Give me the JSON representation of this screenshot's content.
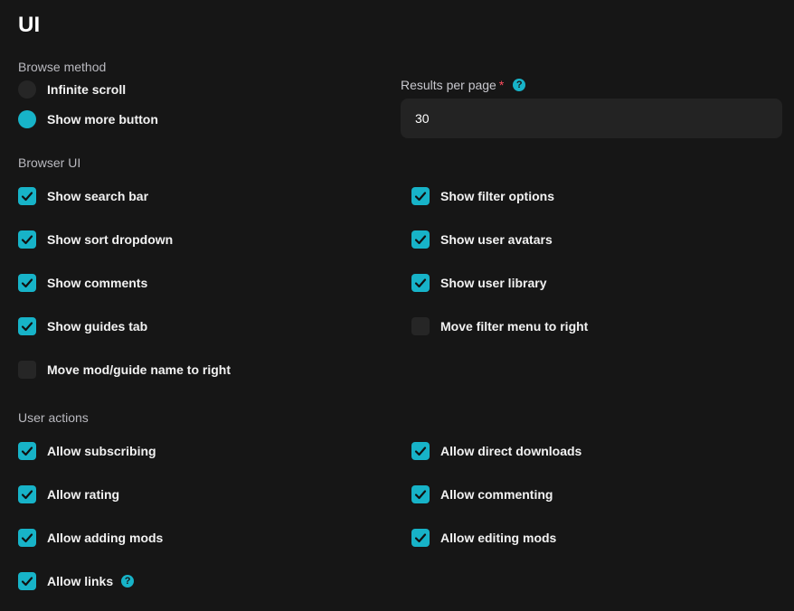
{
  "page": {
    "title": "UI"
  },
  "browse_method": {
    "label": "Browse method",
    "options": [
      {
        "label": "Infinite scroll",
        "selected": false
      },
      {
        "label": "Show more button",
        "selected": true
      }
    ]
  },
  "results_per_page": {
    "label": "Results per page",
    "required_mark": "*",
    "value": "30",
    "help_icon": "question-circle-icon"
  },
  "browser_ui": {
    "label": "Browser UI",
    "options": [
      {
        "label": "Show search bar",
        "checked": true
      },
      {
        "label": "Show filter options",
        "checked": true
      },
      {
        "label": "Show sort dropdown",
        "checked": true
      },
      {
        "label": "Show user avatars",
        "checked": true
      },
      {
        "label": "Show comments",
        "checked": true
      },
      {
        "label": "Show user library",
        "checked": true
      },
      {
        "label": "Show guides tab",
        "checked": true
      },
      {
        "label": "Move filter menu to right",
        "checked": false
      },
      {
        "label": "Move mod/guide name to right",
        "checked": false
      }
    ]
  },
  "user_actions": {
    "label": "User actions",
    "options": [
      {
        "label": "Allow subscribing",
        "checked": true
      },
      {
        "label": "Allow direct downloads",
        "checked": true
      },
      {
        "label": "Allow rating",
        "checked": true
      },
      {
        "label": "Allow commenting",
        "checked": true
      },
      {
        "label": "Allow adding mods",
        "checked": true
      },
      {
        "label": "Allow editing mods",
        "checked": true
      },
      {
        "label": "Allow links",
        "checked": true,
        "help_icon": "question-circle-icon"
      }
    ]
  },
  "colors": {
    "accent": "#17b3c8",
    "background": "#161616",
    "control_off": "#262626",
    "required": "#ff4d5e"
  }
}
